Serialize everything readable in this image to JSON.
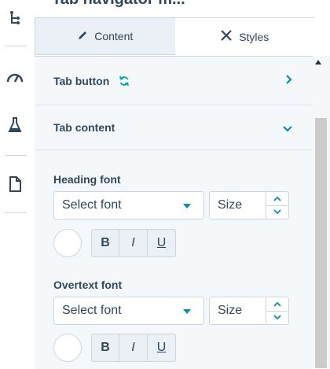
{
  "panel": {
    "title": "Tab navigator m..."
  },
  "tabs": [
    {
      "label": "Content",
      "icon": "pencil-icon"
    },
    {
      "label": "Styles",
      "icon": "styles-icon"
    }
  ],
  "accordions": [
    {
      "label": "Tab button",
      "icon": "sync-icon",
      "state": "collapsed"
    },
    {
      "label": "Tab content",
      "state": "expanded"
    }
  ],
  "fonts": [
    {
      "label": "Heading font",
      "select_placeholder": "Select font",
      "size_placeholder": "Size"
    },
    {
      "label": "Overtext font",
      "select_placeholder": "Select font",
      "size_placeholder": "Size"
    }
  ],
  "format_buttons": [
    "B",
    "I",
    "U"
  ],
  "colors": {
    "accent": "#0091ae",
    "text": "#33475b",
    "border": "#cbd6e2",
    "panel_bg": "#f5f8fa",
    "tab_inactive_bg": "#eaf0f6"
  }
}
